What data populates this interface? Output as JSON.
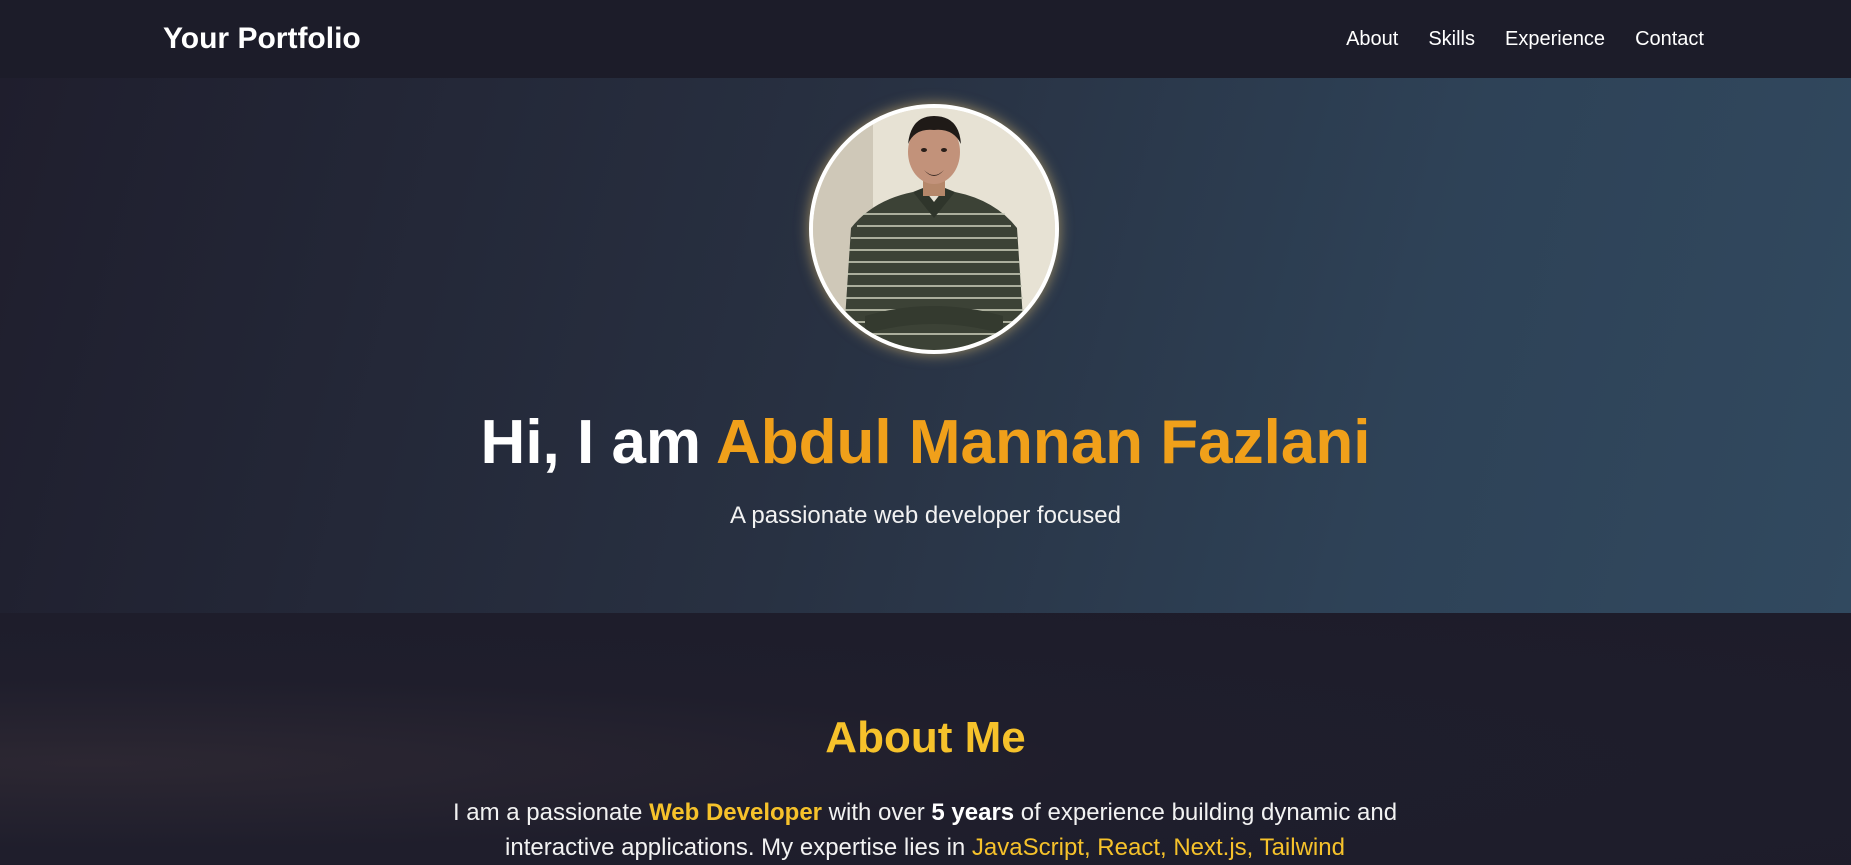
{
  "nav": {
    "brand": "Your Portfolio",
    "links": [
      {
        "label": "About"
      },
      {
        "label": "Skills"
      },
      {
        "label": "Experience"
      },
      {
        "label": "Contact"
      }
    ]
  },
  "hero": {
    "greeting": "Hi, I am ",
    "name": "Abdul Mannan Fazlani",
    "subtitle": "A passionate web developer focused",
    "avatar_icon": "profile-photo"
  },
  "about": {
    "title": "About Me",
    "text_part1": "I am a passionate ",
    "role": "Web Developer",
    "text_part2": " with over ",
    "years": "5 years",
    "text_part3": " of experience building dynamic and interactive applications. My expertise lies in ",
    "tech": "JavaScript, React, Next.js, Tailwind"
  },
  "colors": {
    "accent_orange": "#f0a01a",
    "accent_yellow": "#f6c22b",
    "navbar_bg": "#1c1c29",
    "page_bg": "#1e1d2b"
  }
}
